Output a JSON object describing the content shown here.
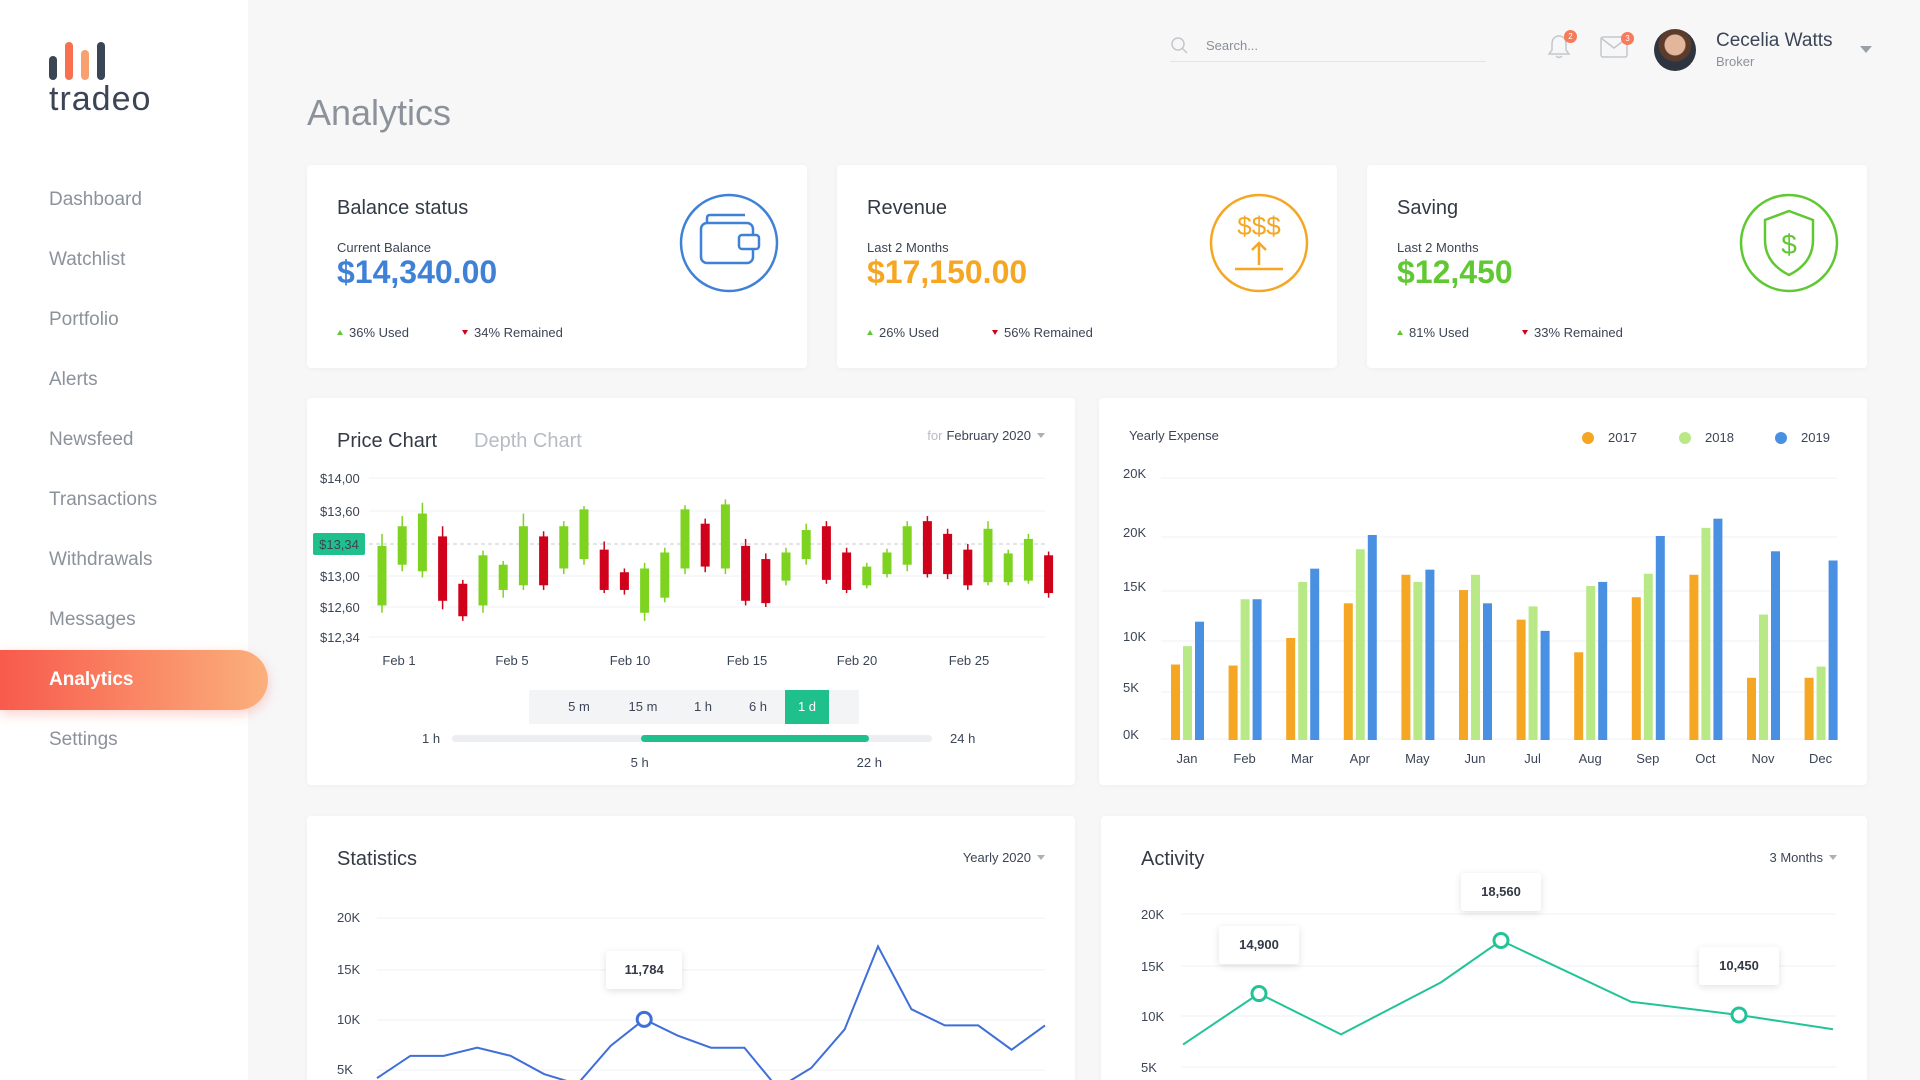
{
  "brand": {
    "name": "tradeo",
    "bar_colors": [
      "#3c4556",
      "#f8704f",
      "#f8a06f",
      "#3c4556"
    ]
  },
  "sidebar": {
    "items": [
      {
        "label": "Dashboard"
      },
      {
        "label": "Watchlist"
      },
      {
        "label": "Portfolio"
      },
      {
        "label": "Alerts"
      },
      {
        "label": "Newsfeed"
      },
      {
        "label": "Transactions"
      },
      {
        "label": "Withdrawals"
      },
      {
        "label": "Messages"
      },
      {
        "label": "Analytics",
        "active": true
      },
      {
        "label": "Settings"
      }
    ]
  },
  "header": {
    "search_placeholder": "Search...",
    "notifications_count": "2",
    "messages_count": "3",
    "user_name": "Cecelia Watts",
    "user_role": "Broker"
  },
  "page_title": "Analytics",
  "stats": [
    {
      "title": "Balance status",
      "subtitle": "Current Balance",
      "value": "$14,340.00",
      "used": "36% Used",
      "remained": "34% Remained",
      "color": "#3f81d6",
      "icon": "wallet-icon"
    },
    {
      "title": "Revenue",
      "subtitle": "Last 2 Months",
      "value": "$17,150.00",
      "used": "26% Used",
      "remained": "56% Remained",
      "color": "#f5a623",
      "icon": "revenue-icon"
    },
    {
      "title": "Saving",
      "subtitle": "Last 2 Months",
      "value": "$12,450",
      "used": "81% Used",
      "remained": "33% Remained",
      "color": "#60c832",
      "icon": "shield-dollar-icon"
    }
  ],
  "price_chart": {
    "tab_active": "Price Chart",
    "tab_inactive": "Depth Chart",
    "period_prefix": "for",
    "period_value": "February 2020",
    "current_price": "$13,34",
    "timeframes": [
      "5 m",
      "15 m",
      "1 h",
      "6 h",
      "1 d"
    ],
    "active_timeframe": "1 d",
    "range": {
      "min_label": "1 h",
      "max_label": "24 h",
      "start_label": "5 h",
      "end_label": "22 h",
      "start": 0.393,
      "end": 0.868
    },
    "up_color": "#7ed321",
    "down_color": "#d0021b"
  },
  "yearly_expense": {
    "title": "Yearly Expense"
  },
  "statistics": {
    "title": "Statistics",
    "period": "Yearly 2020",
    "tooltip": "11,784"
  },
  "activity": {
    "title": "Activity",
    "period": "3 Months",
    "tooltips": [
      "14,900",
      "18,560",
      "10,450"
    ]
  },
  "chart_data": [
    {
      "type": "candlestick",
      "name": "Price Chart",
      "y_ticks": [
        "$14,00",
        "$13,60",
        "$13,34",
        "$13,00",
        "$12,60",
        "$12,34"
      ],
      "x_ticks": [
        "Feb 1",
        "Feb 5",
        "Feb 10",
        "Feb 15",
        "Feb 20",
        "Feb 25"
      ],
      "candles": [
        {
          "o": 12.62,
          "c": 13.32,
          "h": 13.42,
          "l": 12.55
        },
        {
          "o": 13.12,
          "c": 13.48,
          "h": 13.56,
          "l": 13.05
        },
        {
          "o": 13.05,
          "c": 13.58,
          "h": 13.7,
          "l": 12.98
        },
        {
          "o": 13.4,
          "c": 12.68,
          "h": 13.48,
          "l": 12.58
        },
        {
          "o": 12.9,
          "c": 12.52,
          "h": 12.95,
          "l": 12.48
        },
        {
          "o": 12.62,
          "c": 13.22,
          "h": 13.27,
          "l": 12.55
        },
        {
          "o": 12.82,
          "c": 13.12,
          "h": 13.16,
          "l": 12.72
        },
        {
          "o": 12.88,
          "c": 13.48,
          "h": 13.58,
          "l": 12.82
        },
        {
          "o": 13.4,
          "c": 12.88,
          "h": 13.44,
          "l": 12.82
        },
        {
          "o": 13.08,
          "c": 13.48,
          "h": 13.52,
          "l": 13.02
        },
        {
          "o": 13.18,
          "c": 13.62,
          "h": 13.66,
          "l": 13.12
        },
        {
          "o": 13.28,
          "c": 12.82,
          "h": 13.36,
          "l": 12.78
        },
        {
          "o": 13.04,
          "c": 12.82,
          "h": 13.08,
          "l": 12.76
        },
        {
          "o": 12.55,
          "c": 13.08,
          "h": 13.14,
          "l": 12.48
        },
        {
          "o": 12.72,
          "c": 13.25,
          "h": 13.3,
          "l": 12.66
        },
        {
          "o": 13.08,
          "c": 13.62,
          "h": 13.67,
          "l": 13.02
        },
        {
          "o": 13.5,
          "c": 13.1,
          "h": 13.54,
          "l": 13.04
        },
        {
          "o": 13.08,
          "c": 13.68,
          "h": 13.74,
          "l": 13.02
        },
        {
          "o": 13.32,
          "c": 12.68,
          "h": 13.38,
          "l": 12.62
        },
        {
          "o": 13.18,
          "c": 12.65,
          "h": 13.24,
          "l": 12.6
        },
        {
          "o": 12.94,
          "c": 13.25,
          "h": 13.3,
          "l": 12.88
        },
        {
          "o": 13.18,
          "c": 13.45,
          "h": 13.5,
          "l": 13.12
        },
        {
          "o": 13.48,
          "c": 12.95,
          "h": 13.52,
          "l": 12.9
        },
        {
          "o": 13.25,
          "c": 12.82,
          "h": 13.3,
          "l": 12.78
        },
        {
          "o": 12.88,
          "c": 13.1,
          "h": 13.14,
          "l": 12.84
        },
        {
          "o": 13.02,
          "c": 13.25,
          "h": 13.29,
          "l": 12.98
        },
        {
          "o": 13.12,
          "c": 13.48,
          "h": 13.52,
          "l": 13.05
        },
        {
          "o": 13.52,
          "c": 13.02,
          "h": 13.56,
          "l": 12.98
        },
        {
          "o": 13.42,
          "c": 13.02,
          "h": 13.46,
          "l": 12.96
        },
        {
          "o": 13.28,
          "c": 12.88,
          "h": 13.34,
          "l": 12.82
        },
        {
          "o": 12.92,
          "c": 13.46,
          "h": 13.52,
          "l": 12.88
        },
        {
          "o": 12.92,
          "c": 13.24,
          "h": 13.28,
          "l": 12.88
        },
        {
          "o": 12.94,
          "c": 13.38,
          "h": 13.42,
          "l": 12.9
        },
        {
          "o": 13.22,
          "c": 12.78,
          "h": 13.26,
          "l": 12.72
        }
      ]
    },
    {
      "type": "bar",
      "name": "Yearly Expense",
      "categories": [
        "Jan",
        "Feb",
        "Mar",
        "Apr",
        "May",
        "Jun",
        "Jul",
        "Aug",
        "Sep",
        "Oct",
        "Nov",
        "Dec"
      ],
      "y_ticks": [
        "20K",
        "20K",
        "15K",
        "10K",
        "5K",
        "0K"
      ],
      "series": [
        {
          "name": "2017",
          "color": "#f5a623",
          "values": [
            7400,
            7300,
            10000,
            13400,
            16200,
            14700,
            11800,
            8600,
            14000,
            16200,
            6100,
            6100
          ]
        },
        {
          "name": "2018",
          "color": "#b8e986",
          "values": [
            9200,
            13800,
            15500,
            18700,
            15500,
            16200,
            13100,
            15100,
            16300,
            20800,
            12300,
            7200
          ]
        },
        {
          "name": "2019",
          "color": "#4a90e2",
          "values": [
            11600,
            13800,
            16800,
            20100,
            16700,
            13400,
            10700,
            15500,
            20000,
            21700,
            18500,
            17600
          ]
        }
      ]
    },
    {
      "type": "line",
      "name": "Statistics",
      "y_ticks": [
        "20K",
        "15K",
        "10K",
        "5K"
      ],
      "color": "#3f6fd8",
      "x": [
        0,
        1,
        2,
        3,
        4,
        5,
        6,
        7,
        8,
        9,
        10,
        11,
        12,
        13,
        14,
        15,
        16,
        17,
        18,
        19,
        20
      ],
      "values": [
        4200,
        6400,
        6400,
        7200,
        6400,
        4600,
        3600,
        7400,
        10000,
        8400,
        7200,
        7200,
        3200,
        5200,
        9000,
        17200,
        11000,
        9400,
        9400,
        7000,
        9400
      ],
      "highlight_index": 8
    },
    {
      "type": "line",
      "name": "Activity",
      "y_ticks": [
        "20K",
        "15K",
        "10K",
        "5K"
      ],
      "color": "#22c497",
      "values": [
        7200,
        12200,
        8200,
        13300,
        17400,
        11400,
        10100,
        8700
      ],
      "highlight_indices": [
        1,
        4,
        6
      ]
    }
  ]
}
